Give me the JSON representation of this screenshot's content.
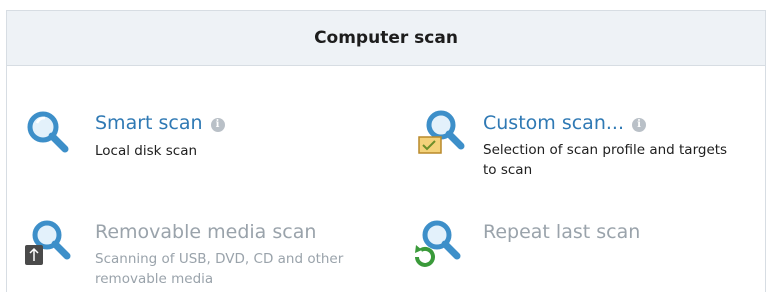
{
  "panel": {
    "title": "Computer scan"
  },
  "scans": {
    "smart": {
      "title": "Smart scan",
      "info_glyph": "i",
      "desc": "Local disk scan",
      "icon": "magnifier-icon"
    },
    "custom": {
      "title": "Custom scan...",
      "info_glyph": "i",
      "desc_line1": "Selection of scan profile and targets",
      "desc_line2": "to scan",
      "icon": "magnifier-checklist-icon"
    },
    "removable": {
      "title": "Removable media scan",
      "desc_line1": "Scanning of USB, DVD, CD and other",
      "desc_line2": "removable media",
      "icon": "magnifier-usb-icon"
    },
    "repeat": {
      "title": "Repeat last scan",
      "icon": "magnifier-repeat-icon"
    }
  },
  "colors": {
    "link_blue": "#2f79b4",
    "disabled_gray": "#9aa3ab",
    "header_bg": "#eef2f6"
  }
}
